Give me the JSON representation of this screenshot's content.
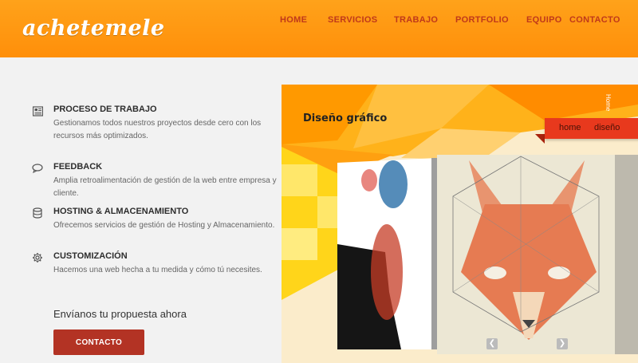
{
  "header": {
    "logo": "achetemele",
    "nav": [
      "HOME",
      "SERVICIOS",
      "TRABAJO",
      "PORTFOLIO",
      "EQUIPO",
      "CONTACTO"
    ]
  },
  "features": [
    {
      "icon": "newspaper-icon",
      "title": "PROCESO DE TRABAJO",
      "desc": "Gestionamos todos nuestros proyectos desde cero con los recursos más optimizados."
    },
    {
      "icon": "chat-bubble-icon",
      "title": "FEEDBACK",
      "desc": "Amplia retroalimentación de gestión de la web entre empresa y cliente."
    },
    {
      "icon": "database-icon",
      "title": "HOSTING & ALMACENAMIENTO",
      "desc": "Ofrecemos servicios de gestión de Hosting y Almacenamiento."
    },
    {
      "icon": "gear-icon",
      "title": "CUSTOMIZACIÓN",
      "desc": "Hacemos una web hecha a tu medida y cómo tú necesites."
    }
  ],
  "cta": {
    "text": "Envíanos tu propuesta ahora",
    "button": "CONTACTO"
  },
  "showcase": {
    "title": "Diseño gráfico",
    "ribbon": [
      "home",
      "diseño"
    ],
    "side_text": "Home"
  },
  "colors": {
    "header_orange": "#ff9a12",
    "nav_text": "#c0391a",
    "button_red": "#b33324",
    "ribbon_red": "#e8391d"
  }
}
